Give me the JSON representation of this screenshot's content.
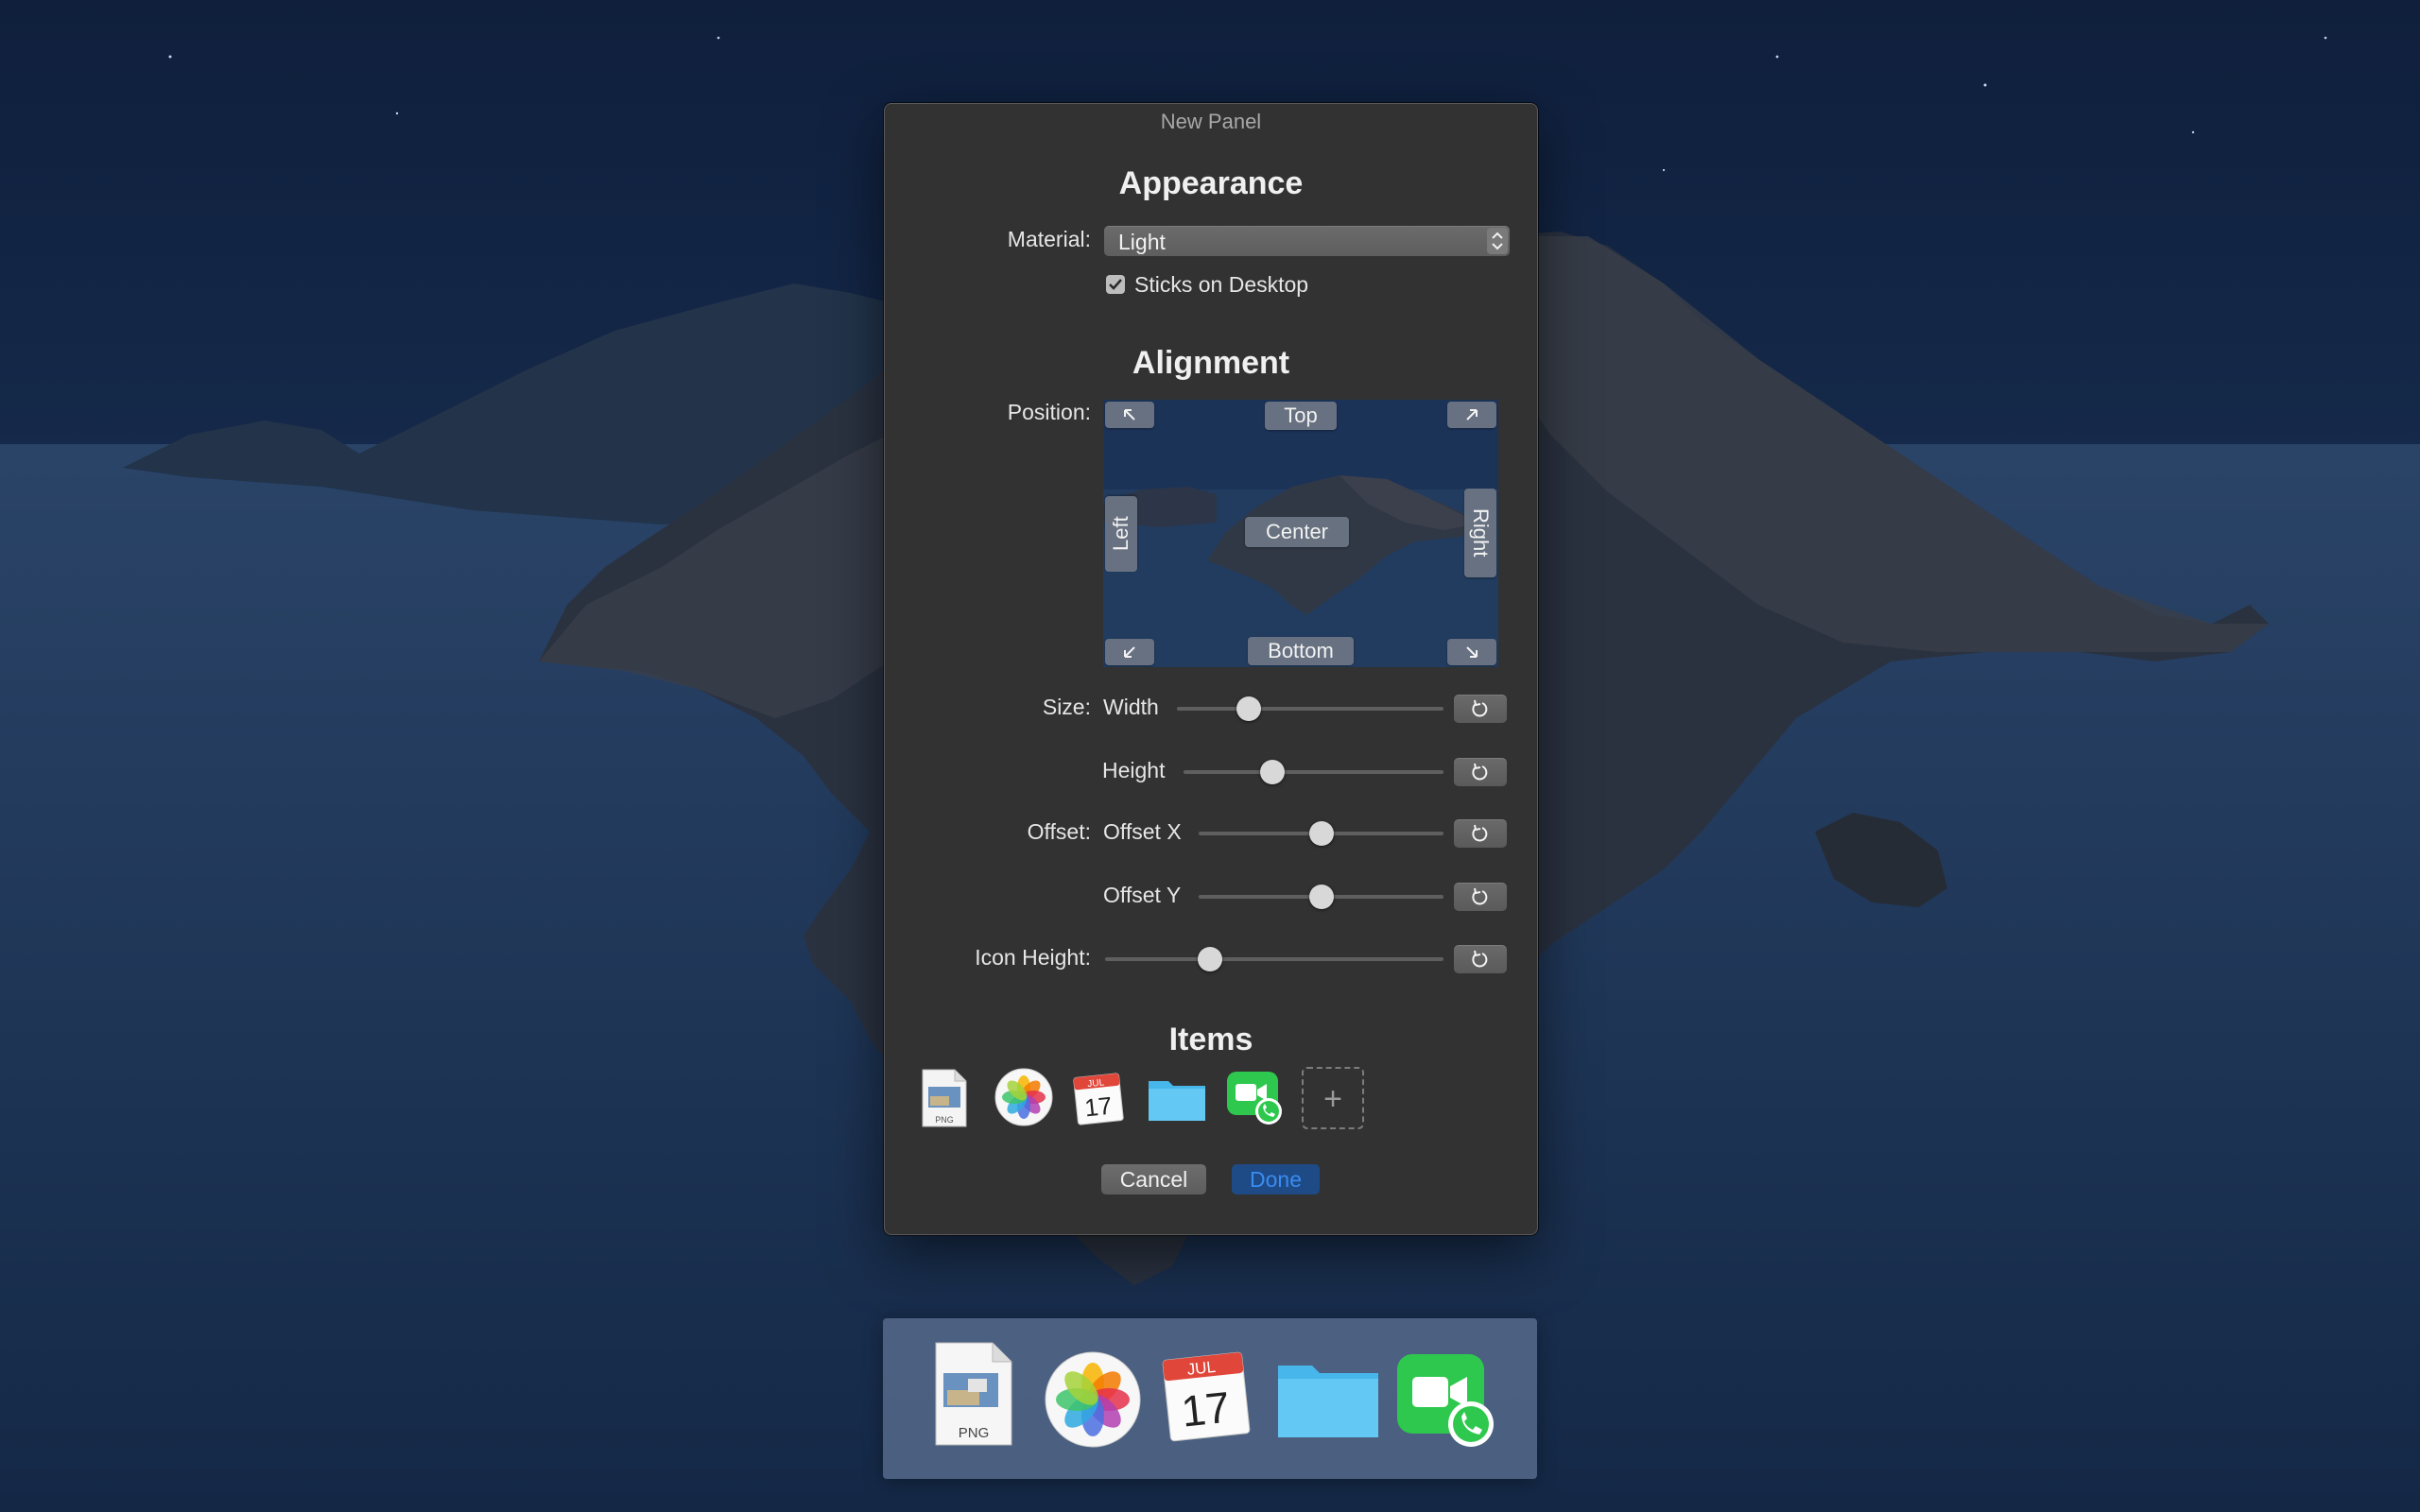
{
  "window": {
    "title": "New Panel"
  },
  "appearance": {
    "heading": "Appearance",
    "material_label": "Material:",
    "material_value": "Light",
    "sticks_label": "Sticks on Desktop",
    "sticks_checked": true
  },
  "alignment": {
    "heading": "Alignment",
    "position_label": "Position:",
    "position_buttons": {
      "top": "Top",
      "bottom": "Bottom",
      "left": "Left",
      "right": "Right",
      "center": "Center"
    },
    "size_label": "Size:",
    "width_label": "Width",
    "width_value": 0.27,
    "height_label": "Height",
    "height_value": 0.34,
    "offset_label": "Offset:",
    "offset_x_label": "Offset X",
    "offset_x_value": 0.5,
    "offset_y_label": "Offset Y",
    "offset_y_value": 0.5,
    "icon_height_label": "Icon Height:",
    "icon_height_value": 0.31
  },
  "items": {
    "heading": "Items",
    "list": [
      "png-file-icon",
      "photos-icon",
      "calendar-icon",
      "folder-icon",
      "facetime-icon"
    ],
    "calendar_month": "JUL",
    "calendar_day": "17",
    "png_caption": "PNG"
  },
  "buttons": {
    "cancel": "Cancel",
    "done": "Done"
  },
  "colors": {
    "accent_done": "#3a8cf0",
    "panel_bg": "#323232"
  }
}
